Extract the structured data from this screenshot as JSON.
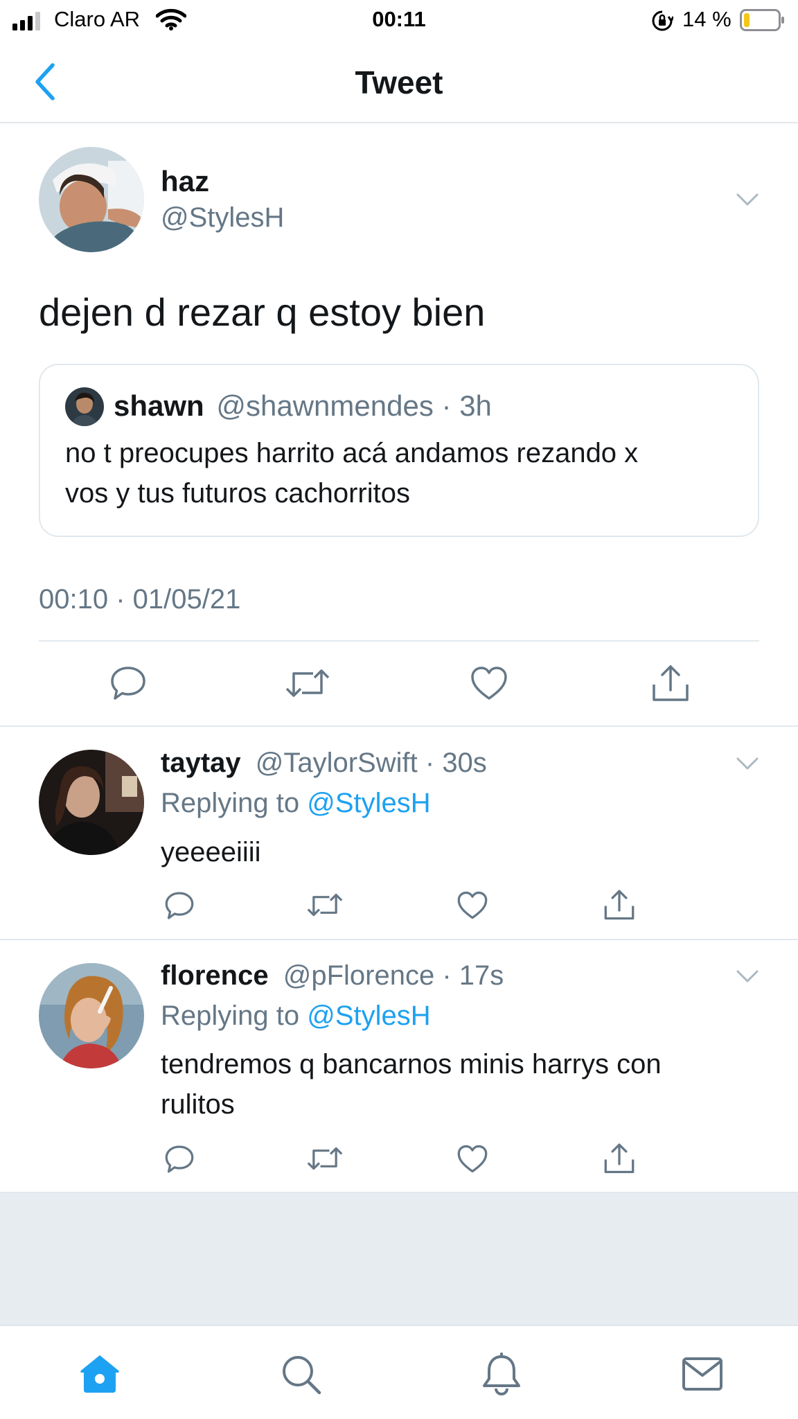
{
  "status_bar": {
    "carrier": "Claro AR",
    "time": "00:11",
    "battery_percent": "14 %"
  },
  "nav": {
    "title": "Tweet"
  },
  "main_tweet": {
    "name": "haz",
    "handle": "@StylesH",
    "text": "dejen d rezar q estoy bien",
    "timestamp": "00:10 · 01/05/21",
    "quote": {
      "name": "shawn",
      "handle": "@shawnmendes",
      "sep": "·",
      "time": "3h",
      "text_line1": "no t preocupes harrito acá andamos rezando x",
      "text_line2": "vos y tus futuros cachorritos"
    }
  },
  "replies": [
    {
      "name": "taytay",
      "handle": "@TaylorSwift",
      "sep": "·",
      "time": "30s",
      "replying_prefix": "Replying to",
      "replying_handle": "@StylesH",
      "text_line1": "yeeeeiiii",
      "text_line2": ""
    },
    {
      "name": "florence",
      "handle": "@pFlorence",
      "sep": "·",
      "time": "17s",
      "replying_prefix": "Replying to",
      "replying_handle": "@StylesH",
      "text_line1": "tendremos q bancarnos minis harrys con",
      "text_line2": "rulitos"
    }
  ],
  "colors": {
    "accent": "#1da1f2",
    "text": "#14171a",
    "muted": "#657786",
    "divider": "#e1e8ed",
    "battery_low": "#f5c518"
  },
  "icons": {
    "back": "chevron-left-icon",
    "more": "chevron-down-icon",
    "reply": "reply-icon",
    "retweet": "retweet-icon",
    "like": "heart-icon",
    "share": "share-icon",
    "home": "home-icon",
    "search": "search-icon",
    "notifications": "bell-icon",
    "messages": "mail-icon"
  }
}
